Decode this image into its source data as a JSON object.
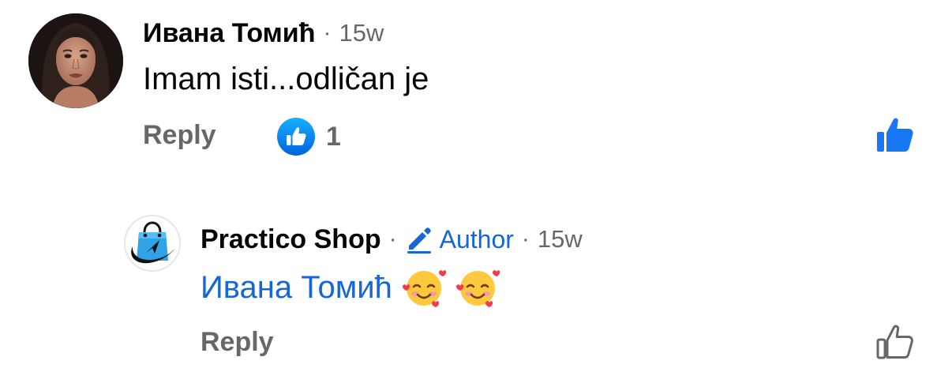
{
  "comments": [
    {
      "author": "Ивана Томић",
      "time": "15w",
      "text": "Imam isti...odličan je",
      "reply_label": "Reply",
      "reaction_count": "1",
      "reaction_icon": "like-reaction-icon",
      "liked": true
    }
  ],
  "reply": {
    "author": "Practico Shop",
    "badge_label": "Author",
    "badge_icon": "pencil-icon",
    "time": "15w",
    "mention": "Ивана Томић",
    "emojis": [
      "smiling-face-with-hearts",
      "smiling-face-with-hearts"
    ],
    "reply_label": "Reply",
    "liked": false
  },
  "separator": "·",
  "colors": {
    "primary_text": "#050505",
    "secondary_text": "#65676b",
    "link_blue": "#1766d6",
    "like_blue": "#1877f2"
  }
}
